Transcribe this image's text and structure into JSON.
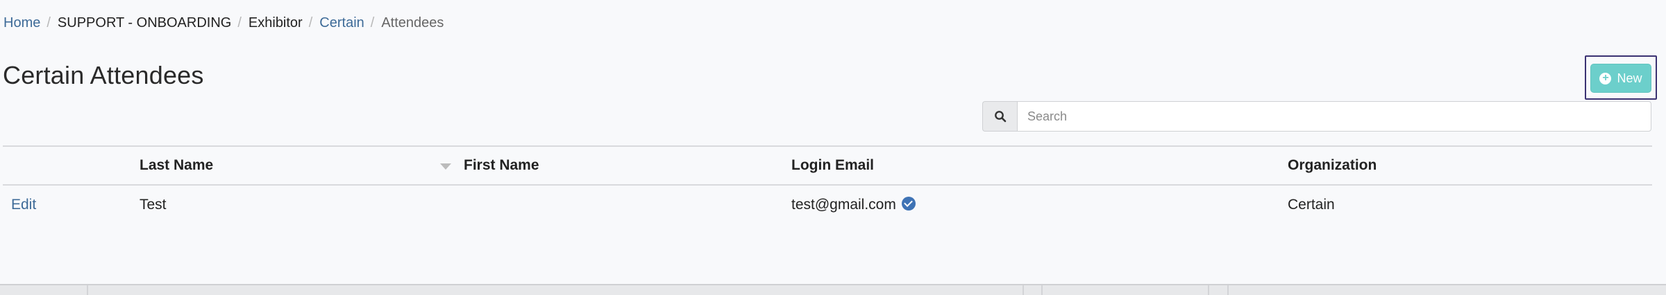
{
  "breadcrumb": {
    "home": "Home",
    "support": "SUPPORT - ONBOARDING",
    "exhibitor": "Exhibitor",
    "certain": "Certain",
    "current": "Attendees",
    "separator": "/"
  },
  "page": {
    "title": "Certain Attendees"
  },
  "toolbar": {
    "new_label": "New",
    "new_icon": "plus-circle-icon",
    "accent_color": "#6ccfcb"
  },
  "search": {
    "placeholder": "Search",
    "value": "",
    "icon": "search-icon"
  },
  "table": {
    "columns": [
      "",
      "Last Name",
      "First Name",
      "Login Email",
      "Organization"
    ],
    "sorted_column": "Last Name",
    "rows": [
      {
        "action": "Edit",
        "last_name": "Test",
        "first_name": "",
        "login_email": "test@gmail.com",
        "email_verified_icon": "verified-check-icon",
        "organization": "Certain"
      }
    ]
  }
}
